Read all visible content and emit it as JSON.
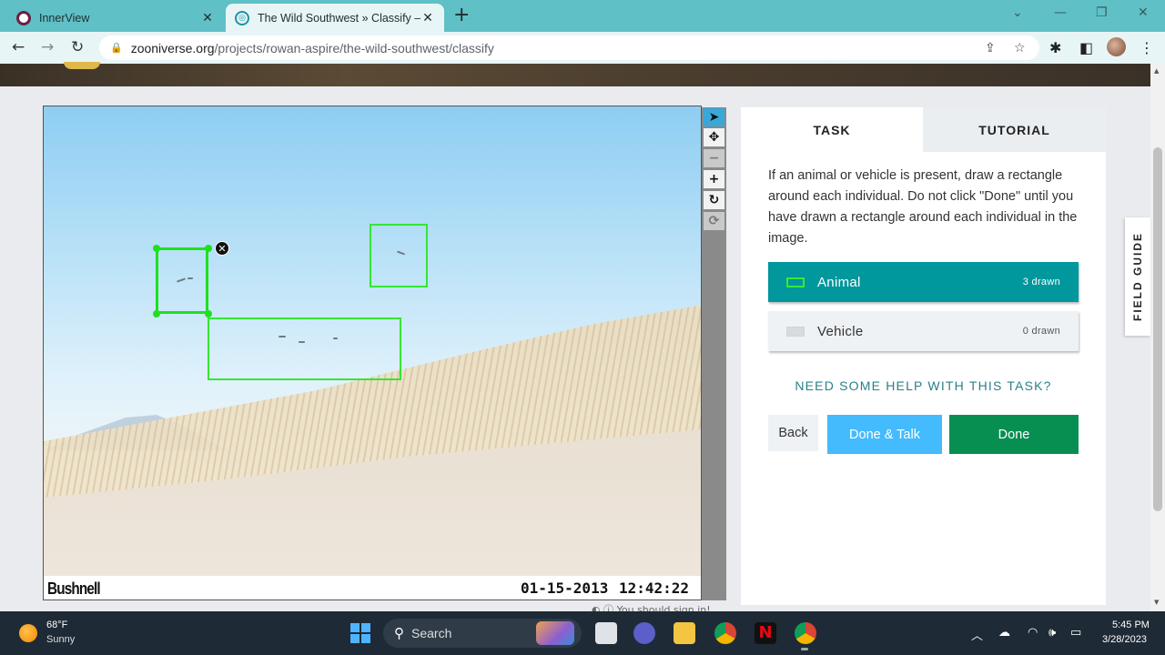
{
  "browser": {
    "tabs": [
      {
        "title": "InnerView",
        "active": false
      },
      {
        "title": "The Wild Southwest » Classify — Zooniverse",
        "active": true
      }
    ],
    "new_tab": "+",
    "address": {
      "host": "zooniverse.org",
      "path": "/projects/rowan-aspire/the-wild-southwest/classify"
    }
  },
  "subject": {
    "brand_stamp": "Bushnell",
    "date_stamp": "01-15-2013",
    "time_stamp": "12:42:22",
    "below_text": "You should sign in!"
  },
  "image_tools": [
    "pointer",
    "pan",
    "zoom-out",
    "zoom-in",
    "rotate",
    "reset"
  ],
  "panel": {
    "tabs": {
      "task": "TASK",
      "tutorial": "TUTORIAL"
    },
    "instructions": "If an animal or vehicle is present, draw a rectangle around each individual. Do not click \"Done\" until you have drawn a rectangle around each individual in the image.",
    "tools": [
      {
        "label": "Animal",
        "count": "3 drawn",
        "color": "#3ae83a",
        "selected": true
      },
      {
        "label": "Vehicle",
        "count": "0 drawn",
        "color": "#d6dbe0",
        "selected": false
      }
    ],
    "help": "NEED SOME HELP WITH THIS TASK?",
    "buttons": {
      "back": "Back",
      "done_talk": "Done & Talk",
      "done": "Done"
    }
  },
  "field_guide": "FIELD GUIDE",
  "taskbar": {
    "weather": {
      "temp": "68°F",
      "desc": "Sunny"
    },
    "search": "Search",
    "time": "5:45 PM",
    "date": "3/28/2023"
  },
  "colors": {
    "teal": "#00979d",
    "done_green": "#078f52",
    "talk_blue": "#43bbfd",
    "box_green": "#35e635"
  }
}
